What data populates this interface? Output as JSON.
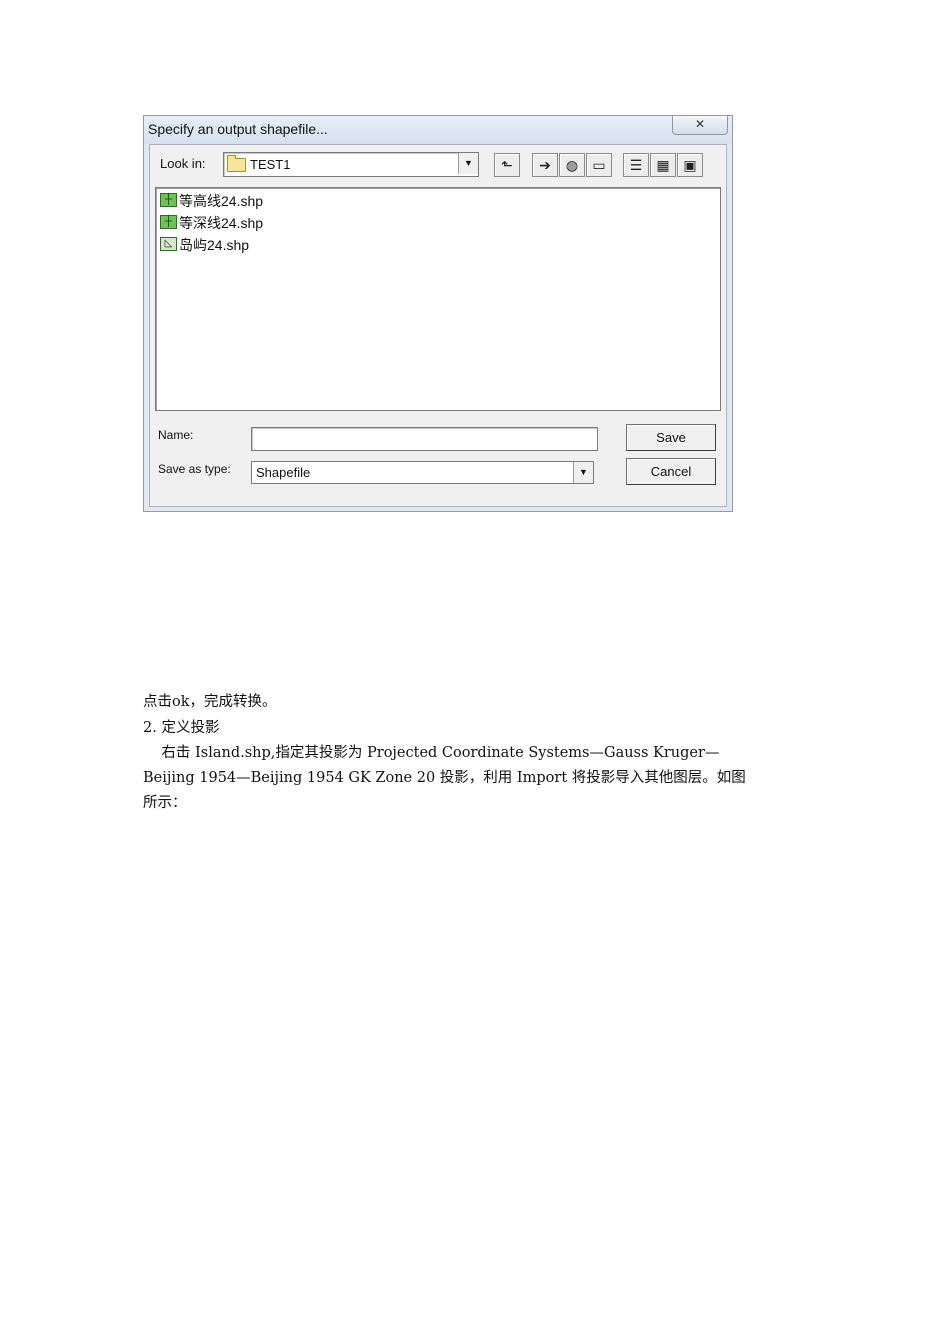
{
  "dialog": {
    "title": "Specify an output shapefile...",
    "close_glyph": "✕",
    "look_in_label": "Look in:",
    "look_in_value": "TEST1",
    "toolbar_icons": [
      "up-folder-icon",
      "add-data-icon",
      "connect-icon",
      "new-folder-icon",
      "list-view-icon",
      "details-view-icon",
      "thumbnails-view-icon"
    ],
    "files": [
      {
        "name": "等高线24.shp",
        "icon": "polyline-shapefile-icon"
      },
      {
        "name": "等深线24.shp",
        "icon": "polyline-shapefile-icon"
      },
      {
        "name": "岛屿24.shp",
        "icon": "polygon-shapefile-icon"
      }
    ],
    "name_label": "Name:",
    "name_value": "",
    "save_as_type_label": "Save as type:",
    "save_as_type_value": "Shapefile",
    "save_label": "Save",
    "cancel_label": "Cancel"
  },
  "text": {
    "line1": "点击ok，完成转换。",
    "heading": "2.  定义投影",
    "line3": "    右击 Island.shp,指定其投影为 Projected Coordinate Systems—Gauss Kruger—",
    "line4": "Beijing 1954—Beijing 1954 GK Zone 20 投影，利用 Import 将投影导入其他图层。如图",
    "line5": "所示："
  }
}
